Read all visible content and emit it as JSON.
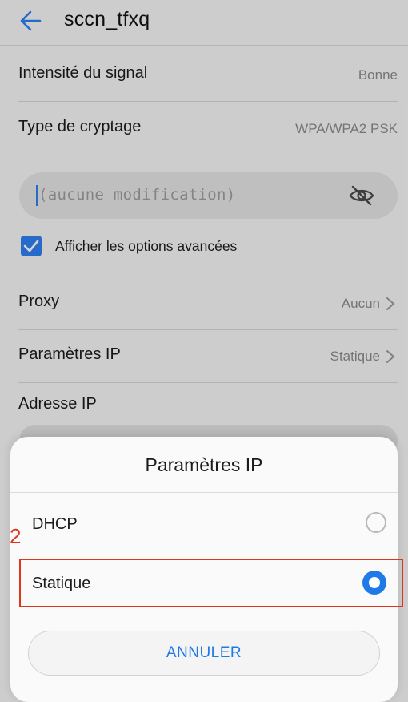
{
  "header": {
    "title": "sccn_tfxq"
  },
  "rows": {
    "signal": {
      "label": "Intensité du signal",
      "value": "Bonne"
    },
    "encryption": {
      "label": "Type de cryptage",
      "value": "WPA/WPA2 PSK"
    },
    "proxy": {
      "label": "Proxy",
      "value": "Aucun"
    },
    "ip_settings": {
      "label": "Paramètres IP",
      "value": "Statique"
    }
  },
  "password": {
    "placeholder": "(aucune modification)"
  },
  "advanced": {
    "label": "Afficher les options avancées",
    "checked": true
  },
  "ip_address": {
    "label": "Adresse IP"
  },
  "sheet": {
    "title": "Paramètres IP",
    "options": [
      {
        "label": "DHCP",
        "selected": false
      },
      {
        "label": "Statique",
        "selected": true
      }
    ],
    "cancel_label": "ANNULER"
  },
  "annotation": {
    "step": "2",
    "color": "#e2341b"
  },
  "colors": {
    "accent": "#1f7ae8"
  }
}
